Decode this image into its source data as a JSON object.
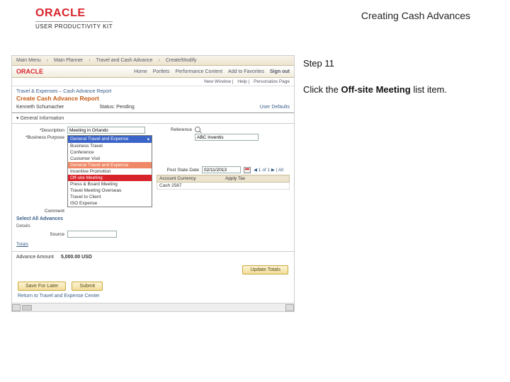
{
  "header": {
    "brand": "ORACLE",
    "subbrand": "USER PRODUCTIVITY KIT",
    "doc_title": "Creating Cash Advances"
  },
  "instruction": {
    "step_label": "Step 11",
    "prefix": "Click the ",
    "bold_item": "Off-site Meeting",
    "suffix": " list item."
  },
  "screenshot": {
    "breadcrumb": [
      "Main Menu",
      "Main Planner",
      "Travel and Cash Advance",
      "Create/Modify"
    ],
    "tabs": [
      "Home",
      "Portlets",
      "Performance Content",
      "Add to Favorites",
      "Sign out"
    ],
    "subbar": [
      "New Window",
      "Help",
      "Personalize Page"
    ],
    "module": "Travel & Expenses – Cash Advance Report",
    "report_title": "Create Cash Advance Report",
    "employee": "Kenneth Schumacher",
    "status_label": "Status:",
    "status_value": "Pending",
    "user_defaults": "User Defaults",
    "general_info": "▾ General Information",
    "left_form": {
      "desc_label": "*Description",
      "desc_value": "Meeting in Orlando",
      "purpose_label": "*Business Purpose",
      "comment_label": "Comment"
    },
    "dropdown": {
      "selected": "General Travel and Expense",
      "options": [
        "Business Travel",
        "Conference",
        "Customer Visit",
        "General Travel and Expense",
        "Incentive Promotion",
        "Off-site Meeting",
        "Press & Board Meeting",
        "Travel Meeting Overseas",
        "Travel to Client",
        "ISO Expense"
      ]
    },
    "right_form": {
      "reference_label": "Reference",
      "reference_value": "ABC Inventis"
    },
    "advances": {
      "header": "Select All Advances",
      "details": "Details",
      "source_label": "Source",
      "date_label": "Post State Date",
      "date_value": "02/11/2013",
      "cols": [
        "Account Currency",
        "",
        "Apply Tax",
        ""
      ],
      "row": [
        "Cash 2587",
        "",
        "",
        ""
      ]
    },
    "advance_amount_label": "Advance Amount",
    "advance_amount_value": "5,000.00   USD",
    "totals": "Totals",
    "update_totals": "Update Totals",
    "save_btn": "Save For Later",
    "submit_btn": "Submit",
    "return_link": "Return to Travel and Expense Center"
  }
}
